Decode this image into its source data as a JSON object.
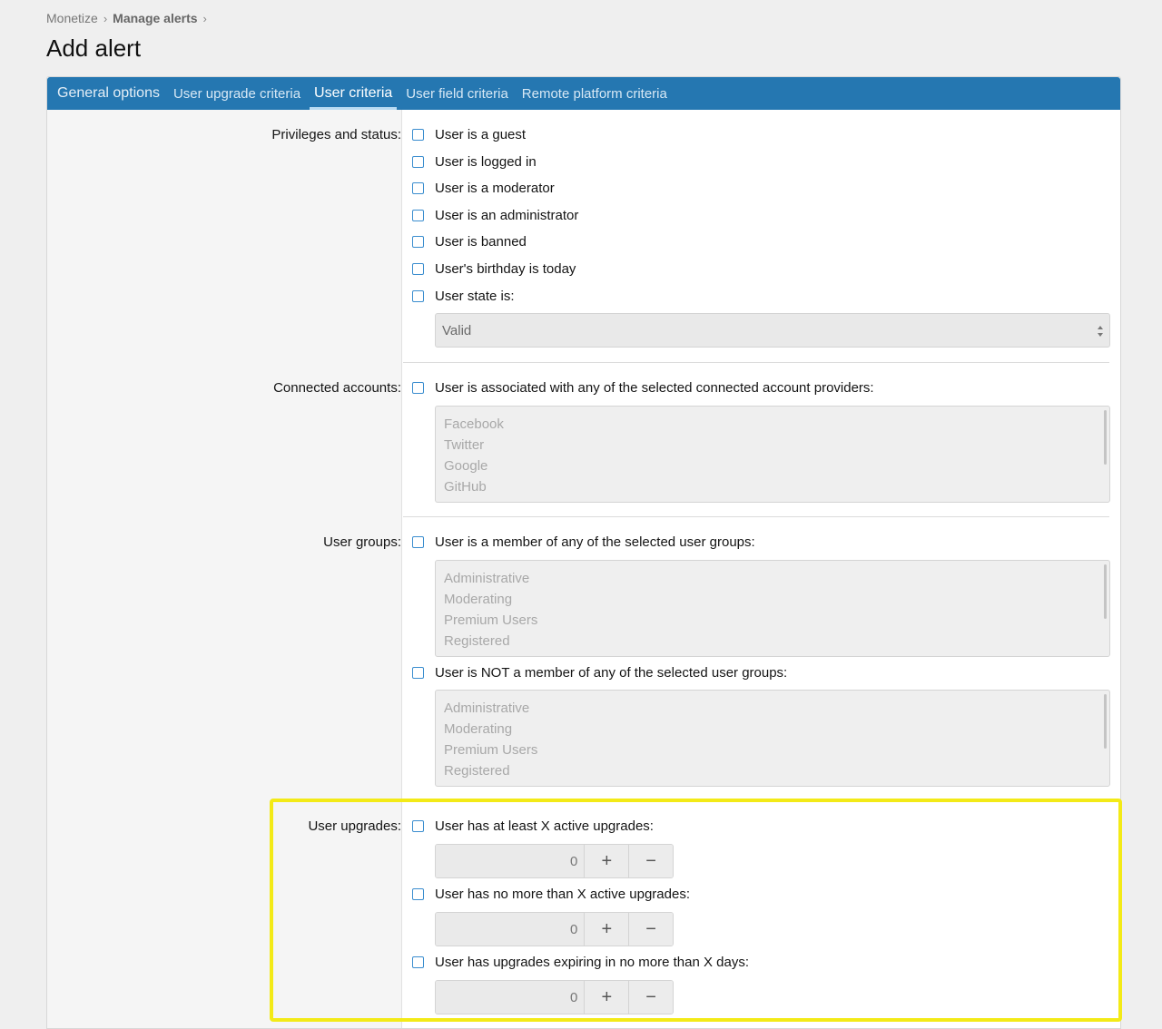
{
  "breadcrumb": {
    "items": [
      "Monetize",
      "Manage alerts"
    ]
  },
  "page_title": "Add alert",
  "tabs": [
    {
      "label": "General options"
    },
    {
      "label": "User upgrade criteria"
    },
    {
      "label": "User criteria",
      "active": true
    },
    {
      "label": "User field criteria"
    },
    {
      "label": "Remote platform criteria"
    }
  ],
  "privileges": {
    "label": "Privileges and status:",
    "options": [
      "User is a guest",
      "User is logged in",
      "User is a moderator",
      "User is an administrator",
      "User is banned",
      "User's birthday is today",
      "User state is:"
    ],
    "state_select": "Valid"
  },
  "connected": {
    "label": "Connected accounts:",
    "option": "User is associated with any of the selected connected account providers:",
    "providers": [
      "Facebook",
      "Twitter",
      "Google",
      "GitHub"
    ]
  },
  "groups": {
    "label": "User groups:",
    "member_option": "User is a member of any of the selected user groups:",
    "member_list": [
      "Administrative",
      "Moderating",
      "Premium Users",
      "Registered"
    ],
    "not_member_option": "User is NOT a member of any of the selected user groups:",
    "not_member_list": [
      "Administrative",
      "Moderating",
      "Premium Users",
      "Registered"
    ]
  },
  "upgrades": {
    "label": "User upgrades:",
    "at_least": {
      "label": "User has at least X active upgrades:",
      "value": "0"
    },
    "no_more": {
      "label": "User has no more than X active upgrades:",
      "value": "0"
    },
    "expiring": {
      "label": "User has upgrades expiring in no more than X days:",
      "value": "0"
    }
  },
  "icons": {
    "plus": "+",
    "minus": "−",
    "chevron": "›"
  },
  "colors": {
    "tabbar": "#2577b1",
    "highlight": "#f3ea17",
    "checkbox_border": "#3a8dcf"
  }
}
